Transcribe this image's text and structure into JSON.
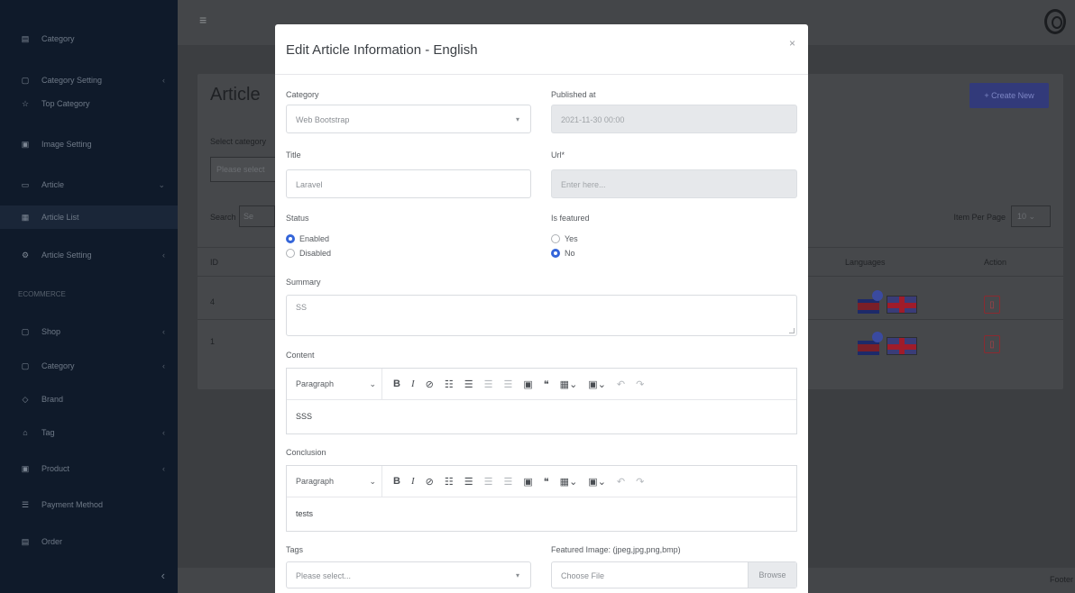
{
  "sidebar": {
    "items": [
      {
        "label": "Category",
        "icon": "list-icon"
      },
      {
        "label": "Category Setting",
        "icon": "folder-icon"
      },
      {
        "label": "Top Category",
        "icon": "star-icon"
      },
      {
        "label": "Image Setting",
        "icon": "image-icon"
      },
      {
        "label": "Article",
        "icon": "file-icon"
      },
      {
        "label": "Article List",
        "icon": "list-icon"
      },
      {
        "label": "Article Setting",
        "icon": "gear-icon"
      }
    ],
    "section_header": "ECOMMERCE",
    "items2": [
      {
        "label": "Shop",
        "icon": "shop-icon"
      },
      {
        "label": "Category",
        "icon": "folder-icon"
      },
      {
        "label": "Brand",
        "icon": "brand-icon"
      },
      {
        "label": "Tag",
        "icon": "tag-icon"
      },
      {
        "label": "Product",
        "icon": "box-icon"
      },
      {
        "label": "Payment Method",
        "icon": "card-icon"
      },
      {
        "label": "Order",
        "icon": "cart-icon"
      }
    ],
    "collapse": "‹"
  },
  "topbar": {
    "menu": "≡"
  },
  "page": {
    "title": "Article",
    "create_button": "+ Create New",
    "select_category_label": "Select category",
    "select_category_placeholder": "Please select",
    "search_label": "Search",
    "search_value": "Se",
    "per_page_label": "Item Per Page",
    "per_page_value": "10",
    "columns": {
      "id": "ID",
      "languages": "Languages",
      "action": "Action"
    },
    "rows": [
      {
        "id": "4"
      },
      {
        "id": "1"
      }
    ]
  },
  "footer": {
    "text": "Footer"
  },
  "modal": {
    "title": "Edit Article Information - English",
    "close": "×",
    "category_label": "Category",
    "category_value": "Web Bootstrap",
    "published_label": "Published at",
    "published_value": "2021-11-30 00:00",
    "title_label": "Title",
    "title_value": "Laravel",
    "url_label": "Url*",
    "url_placeholder": "Enter here...",
    "status_label": "Status",
    "status_options": [
      "Enabled",
      "Disabled"
    ],
    "featured_label": "Is featured",
    "featured_options": [
      "Yes",
      "No"
    ],
    "summary_label": "Summary",
    "summary_value": "SS",
    "content_label": "Content",
    "content_value": "SSS",
    "conclusion_label": "Conclusion",
    "conclusion_value": "tests",
    "toolbar_paragraph": "Paragraph",
    "tags_label": "Tags",
    "tags_placeholder": "Please select...",
    "featured_image_label": "Featured Image: (jpeg,jpg,png,bmp)",
    "file_placeholder": "Choose File",
    "browse": "Browse"
  }
}
